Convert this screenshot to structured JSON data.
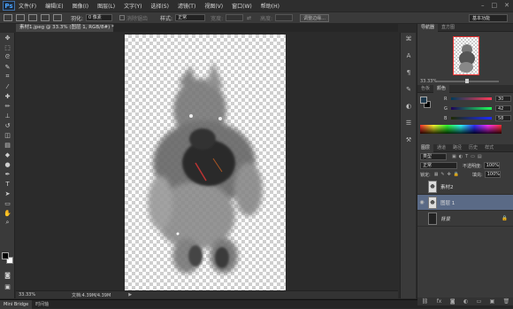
{
  "app": {
    "logo": "Ps"
  },
  "menu": [
    "文件(F)",
    "编辑(E)",
    "图像(I)",
    "图层(L)",
    "文字(Y)",
    "选择(S)",
    "滤镜(T)",
    "视图(V)",
    "窗口(W)",
    "帮助(H)"
  ],
  "options": {
    "feather_label": "羽化:",
    "feather_value": "0 像素",
    "antialias_label": "消除锯齿",
    "style_label": "样式:",
    "style_value": "正常",
    "width_label": "宽度:",
    "height_label": "高度:",
    "refine_label": "调整边缘...",
    "workspace": "基本功能"
  },
  "document": {
    "tab_title": "素材1.jpeg @ 33.3% (图层 1, RGB/8#) *"
  },
  "status": {
    "zoom": "33.33%",
    "doc_info": "文档:4.39M/4.39M"
  },
  "bottom_tabs": [
    "Mini Bridge",
    "时间轴"
  ],
  "navigator": {
    "tabs": [
      "导航器",
      "直方图"
    ],
    "zoom": "33.33%"
  },
  "color_panel": {
    "tabs": [
      "色板",
      "颜色"
    ],
    "r": "30",
    "g": "42",
    "b": "58",
    "fg_color": "#1e2a3a"
  },
  "layers_panel": {
    "tabs": [
      "图层",
      "通道",
      "路径",
      "历史",
      "样式"
    ],
    "kind_label": "类型",
    "blend_mode": "正常",
    "opacity_label": "不透明度:",
    "opacity": "100%",
    "lock_label": "锁定:",
    "fill_label": "填充:",
    "fill": "100%",
    "layers": [
      {
        "name": "素材2",
        "visible": false,
        "selected": false
      },
      {
        "name": "图层 1",
        "visible": true,
        "selected": true
      },
      {
        "name": "背景",
        "visible": false,
        "selected": false
      }
    ]
  }
}
